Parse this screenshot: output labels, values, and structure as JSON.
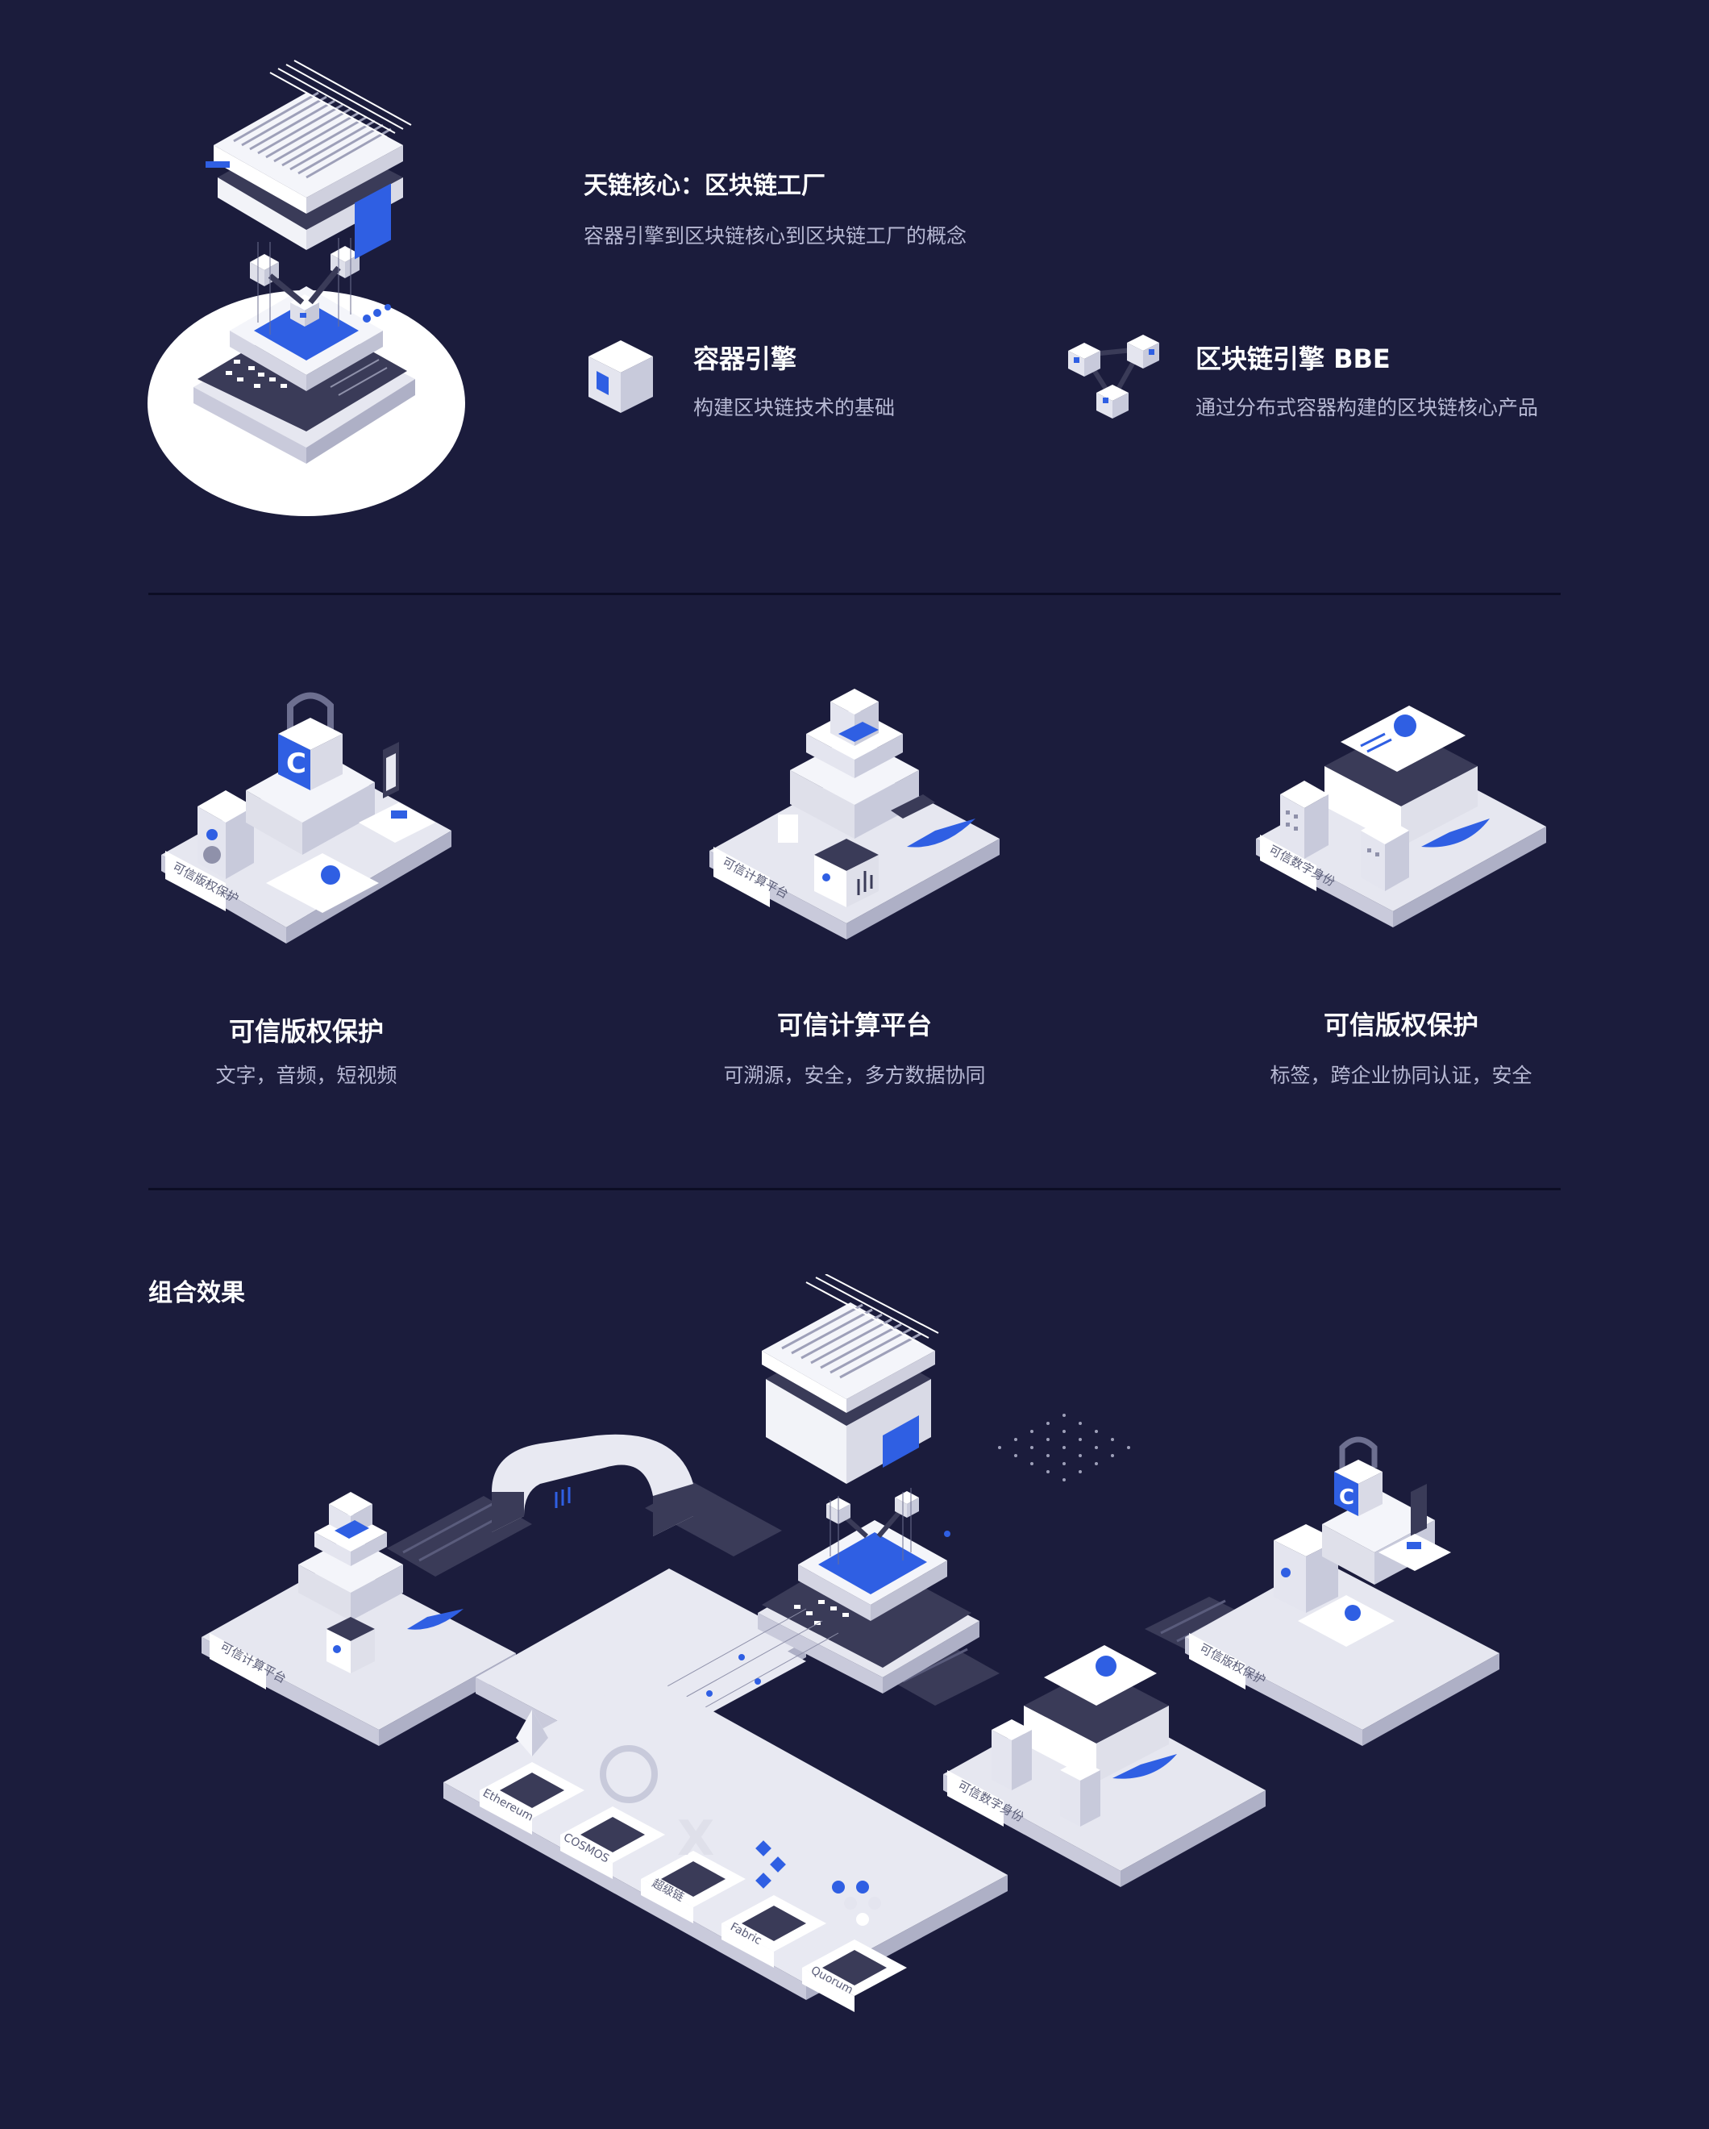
{
  "hero": {
    "title": "天链核心：区块链工厂",
    "subtitle": "容器引擎到区块链核心到区块链工厂的概念"
  },
  "features": [
    {
      "title": "容器引擎",
      "desc": "构建区块链技术的基础",
      "icon": "cube-icon"
    },
    {
      "title": "区块链引擎 BBE",
      "desc": "通过分布式容器构建的区块链核心产品",
      "icon": "molecule-icon"
    }
  ],
  "cards": [
    {
      "title": "可信版权保护",
      "desc": "文字，音频，短视频",
      "label": "可信版权保护"
    },
    {
      "title": "可信计算平台",
      "desc": "可溯源，安全，多方数据协同",
      "label": "可信计算平台"
    },
    {
      "title": "可信版权保护",
      "desc": "标签，跨企业协同认证，安全",
      "label": "可信数字身份"
    }
  ],
  "combo": {
    "title": "组合效果",
    "labels": {
      "compute": "可信计算平台",
      "identity": "可信数字身份",
      "copyright": "可信版权保护"
    },
    "chains": [
      "Ethereum",
      "COSMOS",
      "超级链",
      "Fabric",
      "Quorum"
    ]
  },
  "colors": {
    "background": "#1b1c3c",
    "accent": "#2f5fe3",
    "platform": "#e8e9f2",
    "dark": "#3a3b58"
  }
}
